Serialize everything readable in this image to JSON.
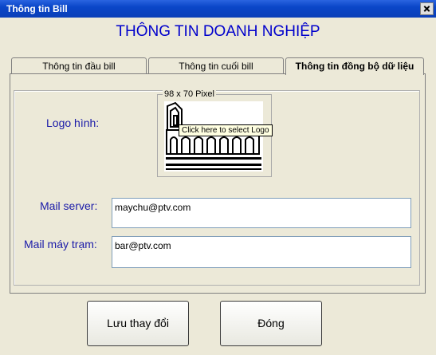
{
  "window": {
    "title": "Thông tin Bill"
  },
  "heading": "THÔNG TIN DOANH NGHIỆP",
  "tabs": [
    {
      "label": "Thông tin đầu bill"
    },
    {
      "label": "Thông tin cuối bill"
    },
    {
      "label": "Thông tin đồng bộ dữ liệu"
    }
  ],
  "logo": {
    "label": "Logo hình:",
    "box_caption": "98 x 70 Pixel",
    "tooltip": "Click here to select Logo"
  },
  "mail_server": {
    "label": "Mail server:",
    "value": "maychu@ptv.com"
  },
  "mail_client": {
    "label": "Mail máy trạm:",
    "value": "bar@ptv.com"
  },
  "buttons": {
    "save": "Lưu thay đổi",
    "close": "Đóng"
  }
}
